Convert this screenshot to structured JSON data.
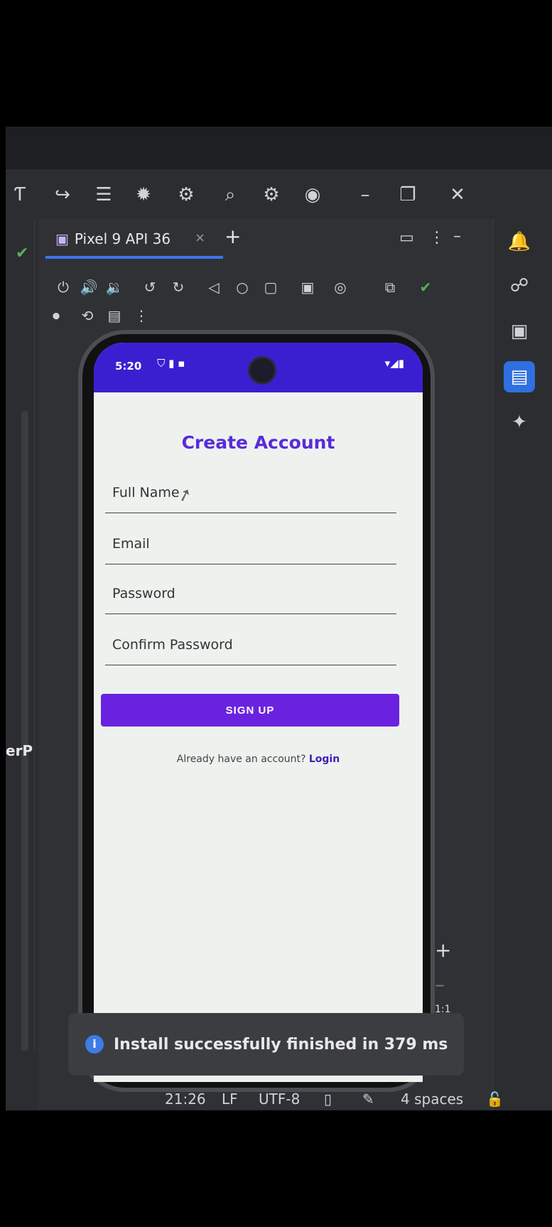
{
  "ide": {
    "tab": {
      "label": "Pixel 9 API 36",
      "close": "×",
      "add": "+"
    },
    "left_text": "erP"
  },
  "app": {
    "status": {
      "time": "5:20"
    },
    "title": "Create Account",
    "fields": [
      {
        "label": "Full Name"
      },
      {
        "label": "Email"
      },
      {
        "label": "Password"
      },
      {
        "label": "Confirm Password"
      }
    ],
    "signup_label": "SIGN UP",
    "have_account_text": "Already have an account? ",
    "login_label": "Login"
  },
  "toast": {
    "icon": "info-icon",
    "text": "Install successfully finished in 379 ms"
  },
  "statusbar": {
    "position": "21:26",
    "line_sep": "LF",
    "encoding": "UTF-8",
    "indent": "4 spaces"
  },
  "zoom": {
    "one_to_one": "1:1"
  }
}
